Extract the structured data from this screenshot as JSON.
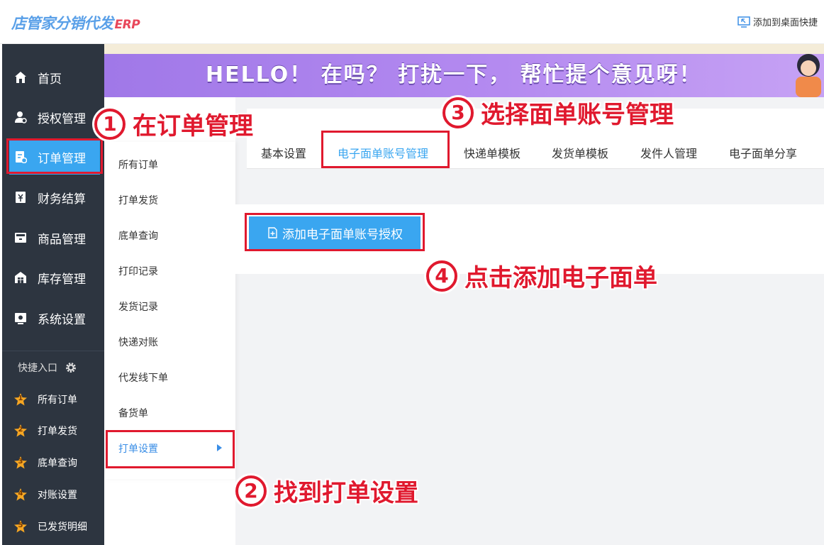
{
  "app": {
    "logo_text": "店管家分销代发",
    "logo_suffix": "ERP",
    "add_to_desktop": "添加到桌面快捷"
  },
  "banner": {
    "text": "HELLO！ 在吗？ 打扰一下，  帮忙提个意见呀！"
  },
  "sidebar": {
    "items": [
      {
        "label": "首页",
        "icon": "home-icon"
      },
      {
        "label": "授权管理",
        "icon": "user-auth-icon"
      },
      {
        "label": "订单管理",
        "icon": "order-icon",
        "active": true
      },
      {
        "label": "财务结算",
        "icon": "finance-icon"
      },
      {
        "label": "商品管理",
        "icon": "goods-icon"
      },
      {
        "label": "库存管理",
        "icon": "warehouse-icon"
      },
      {
        "label": "系统设置",
        "icon": "settings-icon"
      }
    ],
    "quick_title": "快捷入口",
    "quick_items": [
      {
        "num": "1",
        "label": "所有订单"
      },
      {
        "num": "2",
        "label": "打单发货"
      },
      {
        "num": "3",
        "label": "底单查询"
      },
      {
        "num": "4",
        "label": "对账设置"
      },
      {
        "num": "5",
        "label": "已发货明细"
      }
    ]
  },
  "submenu": {
    "items": [
      "所有订单",
      "打单发货",
      "底单查询",
      "打印记录",
      "发货记录",
      "快递对账",
      "代发线下单",
      "备货单",
      "打单设置"
    ],
    "active": "打单设置"
  },
  "tabs": {
    "items": [
      "基本设置",
      "电子面单账号管理",
      "快递单模板",
      "发货单模板",
      "发件人管理",
      "电子面单分享"
    ],
    "active": "电子面单账号管理"
  },
  "actions": {
    "add_button": "添加电子面单账号授权"
  },
  "annotations": [
    {
      "num": "1",
      "text": "在订单管理"
    },
    {
      "num": "2",
      "text": "找到打单设置"
    },
    {
      "num": "3",
      "text": "选择面单账号管理"
    },
    {
      "num": "4",
      "text": "点击添加电子面单"
    }
  ],
  "colors": {
    "sidebar_bg": "#2d3540",
    "accent": "#3aa6f0",
    "annotation_red": "#e0192e",
    "banner_purple": "#a078e8"
  }
}
